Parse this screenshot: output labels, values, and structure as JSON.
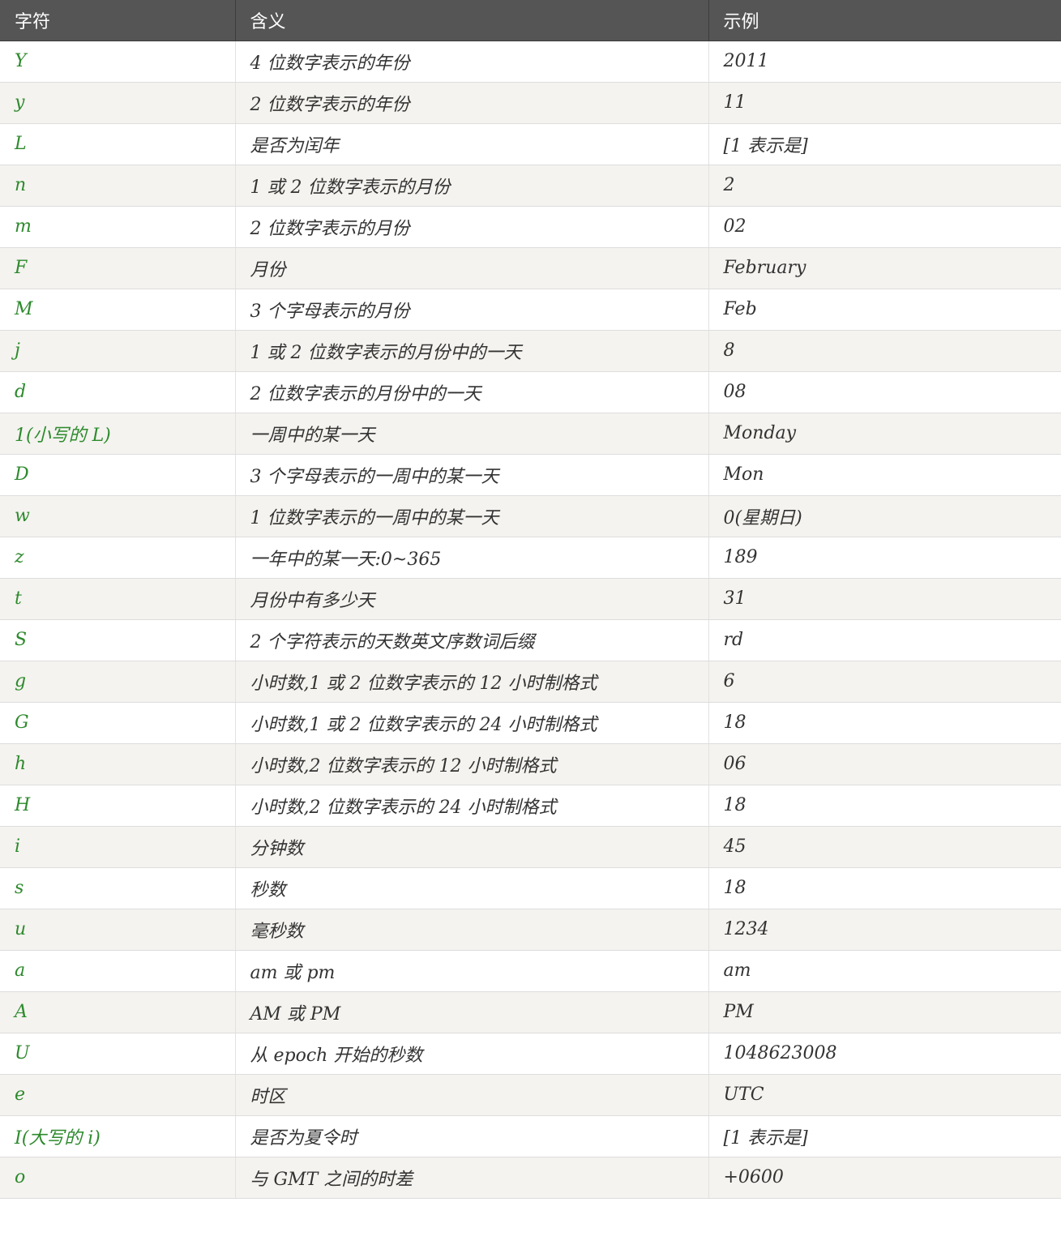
{
  "header": {
    "col1": "字符",
    "col2": "含义",
    "col3": "示例"
  },
  "colors": {
    "header_bg": "#555555",
    "header_text": "#ffffff",
    "char_text": "#2d8a2d",
    "stripe_bg": "#f4f3ef"
  },
  "rows": [
    {
      "char": "Y",
      "meaning": "4 位数字表示的年份",
      "example": "2011"
    },
    {
      "char": "y",
      "meaning": "2 位数字表示的年份",
      "example": "11"
    },
    {
      "char": "L",
      "meaning": "是否为闰年",
      "example": "[1 表示是]"
    },
    {
      "char": "n",
      "meaning": "1 或 2 位数字表示的月份",
      "example": "2"
    },
    {
      "char": "m",
      "meaning": "2 位数字表示的月份",
      "example": "02"
    },
    {
      "char": "F",
      "meaning": "月份",
      "example": "February"
    },
    {
      "char": "M",
      "meaning": "3 个字母表示的月份",
      "example": "Feb"
    },
    {
      "char": "j",
      "meaning": "1 或 2 位数字表示的月份中的一天",
      "example": "8"
    },
    {
      "char": "d",
      "meaning": "2 位数字表示的月份中的一天",
      "example": "08"
    },
    {
      "char": "1(小写的 L)",
      "meaning": "一周中的某一天",
      "example": "Monday"
    },
    {
      "char": "D",
      "meaning": "3 个字母表示的一周中的某一天",
      "example": "Mon"
    },
    {
      "char": "w",
      "meaning": "1 位数字表示的一周中的某一天",
      "example": "0(星期日)"
    },
    {
      "char": "z",
      "meaning": "一年中的某一天:0~365",
      "example": "189"
    },
    {
      "char": "t",
      "meaning": "月份中有多少天",
      "example": "31"
    },
    {
      "char": "S",
      "meaning": "2 个字符表示的天数英文序数词后缀",
      "example": "rd"
    },
    {
      "char": "g",
      "meaning": "小时数,1 或 2 位数字表示的 12 小时制格式",
      "example": "6"
    },
    {
      "char": "G",
      "meaning": "小时数,1 或 2 位数字表示的 24 小时制格式",
      "example": "18"
    },
    {
      "char": "h",
      "meaning": "小时数,2 位数字表示的 12 小时制格式",
      "example": "06"
    },
    {
      "char": "H",
      "meaning": "小时数,2 位数字表示的 24 小时制格式",
      "example": "18"
    },
    {
      "char": "i",
      "meaning": "分钟数",
      "example": "45"
    },
    {
      "char": "s",
      "meaning": "秒数",
      "example": "18"
    },
    {
      "char": "u",
      "meaning": "毫秒数",
      "example": "1234"
    },
    {
      "char": "a",
      "meaning": "am 或 pm",
      "example": "am"
    },
    {
      "char": "A",
      "meaning": "AM 或 PM",
      "example": "PM"
    },
    {
      "char": "U",
      "meaning": "从 epoch 开始的秒数",
      "example": "1048623008"
    },
    {
      "char": "e",
      "meaning": "时区",
      "example": "UTC"
    },
    {
      "char": "I(大写的 i)",
      "meaning": "是否为夏令时",
      "example": "[1 表示是]"
    },
    {
      "char": "o",
      "meaning": "与 GMT 之间的时差",
      "example": "+0600"
    }
  ]
}
